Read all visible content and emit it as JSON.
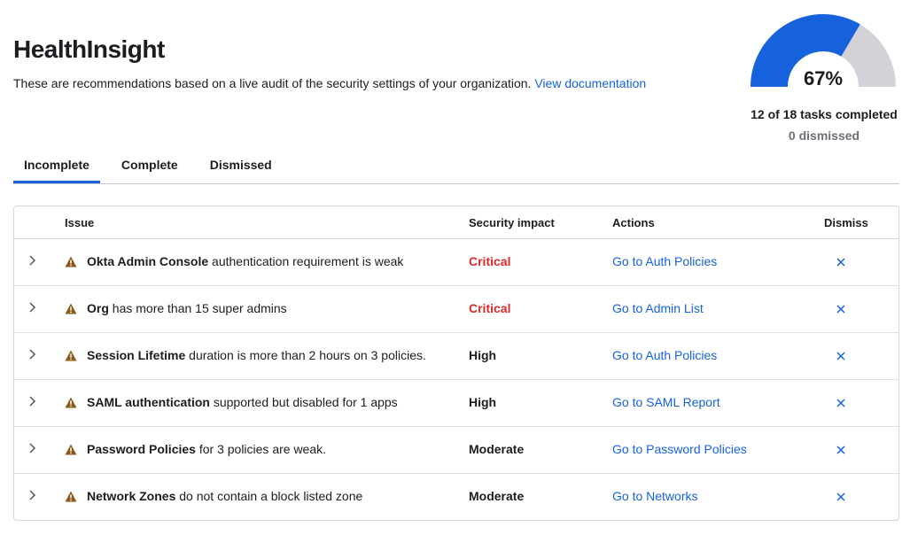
{
  "header": {
    "title": "HealthInsight",
    "subtitle": "These are recommendations based on a live audit of the security settings of your organization.",
    "doc_link": "View documentation"
  },
  "progress": {
    "percent_label": "67%",
    "fraction_complete": 0.67,
    "tasks_completed": "12 of 18 tasks completed",
    "dismissed": "0 dismissed",
    "fill_color": "#1662dd",
    "track_color": "#d2d2d8"
  },
  "tabs": [
    {
      "label": "Incomplete",
      "active": true
    },
    {
      "label": "Complete",
      "active": false
    },
    {
      "label": "Dismissed",
      "active": false
    }
  ],
  "table": {
    "headers": {
      "issue": "Issue",
      "impact": "Security impact",
      "actions": "Actions",
      "dismiss": "Dismiss"
    },
    "rows": [
      {
        "bold": "Okta Admin Console",
        "rest": " authentication requirement is weak",
        "impact": "Critical",
        "action": "Go to Auth Policies"
      },
      {
        "bold": "Org",
        "rest": " has more than 15 super admins",
        "impact": "Critical",
        "action": "Go to Admin List"
      },
      {
        "bold": "Session Lifetime",
        "rest": " duration is more than 2 hours on 3 policies.",
        "impact": "High",
        "action": "Go to Auth Policies"
      },
      {
        "bold": "SAML authentication",
        "rest": " supported but disabled for 1 apps",
        "impact": "High",
        "action": "Go to SAML Report"
      },
      {
        "bold": "Password Policies",
        "rest": " for 3 policies are weak.",
        "impact": "Moderate",
        "action": "Go to Password Policies"
      },
      {
        "bold": "Network Zones",
        "rest": " do not contain a block listed zone",
        "impact": "Moderate",
        "action": "Go to Networks"
      }
    ]
  },
  "colors": {
    "critical": "#d92b2b",
    "link": "#1662dd",
    "warning": "#8b5a1e"
  }
}
